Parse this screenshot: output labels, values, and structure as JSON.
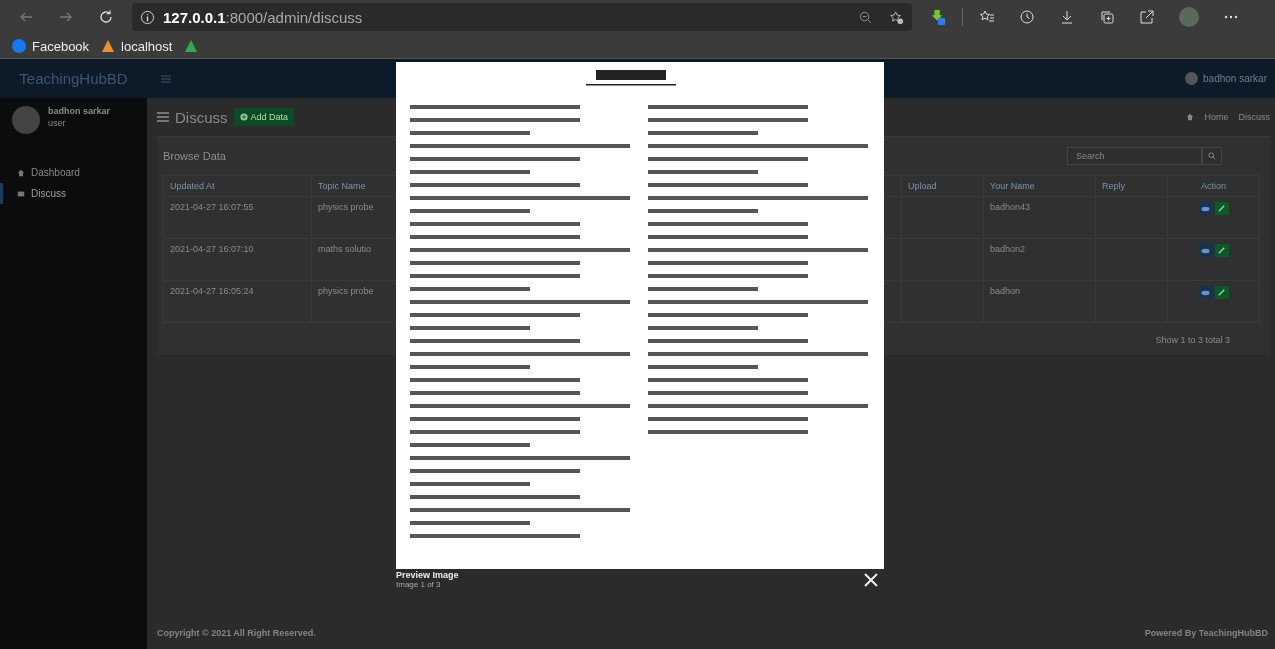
{
  "browser": {
    "url_host": "127.0.0.1",
    "url_path": ":8000/admin/discuss",
    "bookmarks": [
      {
        "kind": "facebook",
        "label": "Facebook"
      },
      {
        "kind": "localhost",
        "label": "localhost"
      },
      {
        "kind": "drive"
      }
    ]
  },
  "header": {
    "brand": "TeachingHubBD",
    "user": "badhon sarkar"
  },
  "sidebar": {
    "user": {
      "name": "badhon sarkar",
      "role": "user"
    },
    "items": [
      {
        "label": "Dashboard",
        "selected": false
      },
      {
        "label": "Discuss",
        "selected": true
      }
    ]
  },
  "page": {
    "title": "Discuss",
    "add_button": "Add Data",
    "breadcrumb": [
      "Home",
      "Discuss"
    ]
  },
  "card": {
    "title": "Browse Data",
    "search": {
      "placeholder": "Search"
    },
    "columns": [
      "Updated At",
      "Topic Name",
      "Upload",
      "Your Name",
      "Reply",
      "Action"
    ],
    "rows": [
      {
        "updated_at": "2021-04-27 16:07:55",
        "topic_name": "physics probe",
        "your_name": "badhon43"
      },
      {
        "updated_at": "2021-04-27 16:07:10",
        "topic_name": "maths solutio",
        "your_name": "badhon2"
      },
      {
        "updated_at": "2021-04-27 16:05:24",
        "topic_name": "physics probe",
        "your_name": "badhon"
      }
    ],
    "pagination": "Show 1 to 3 total 3"
  },
  "footer": {
    "left": "Copyright © 2021 All Right Reserved.",
    "right": "Powered By TeachingHubBD"
  },
  "lightbox": {
    "title": "Preview Image",
    "counter": "Image 1 of 3"
  }
}
